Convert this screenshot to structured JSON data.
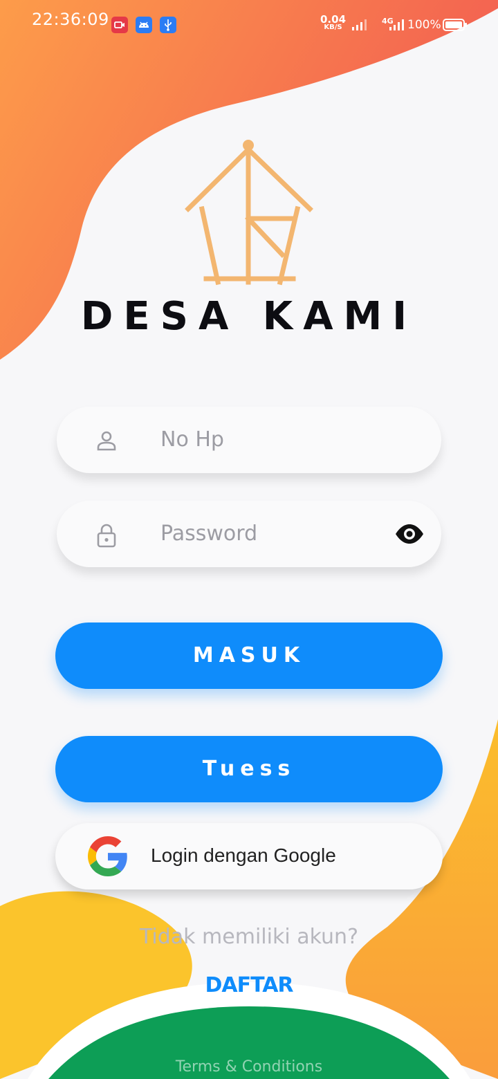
{
  "status_bar": {
    "time": "22:36:09",
    "net_speed_value": "0.04",
    "net_speed_unit": "KB/S",
    "network_type": "4G",
    "battery": "100%",
    "notification_icons": [
      "screen-record-icon",
      "android-icon",
      "usb-icon"
    ]
  },
  "app": {
    "brand": "DESA KAMI",
    "logo_icon": "house-logo-icon"
  },
  "form": {
    "phone_placeholder": "No Hp",
    "password_placeholder": "Password",
    "login_button": "MASUK",
    "secondary_button": "Tuess",
    "google_button": "Login dengan Google",
    "no_account_text": "Tidak memiliki akun?",
    "register_link": "DAFTAR",
    "terms_link": "Terms & Conditions"
  },
  "colors": {
    "accent": "#0f8cfb",
    "top_blob_start": "#fd9c4a",
    "top_blob_end": "#f25c52",
    "yellow": "#fbc42c",
    "green": "#0d9e56",
    "logo": "#f3b670"
  }
}
